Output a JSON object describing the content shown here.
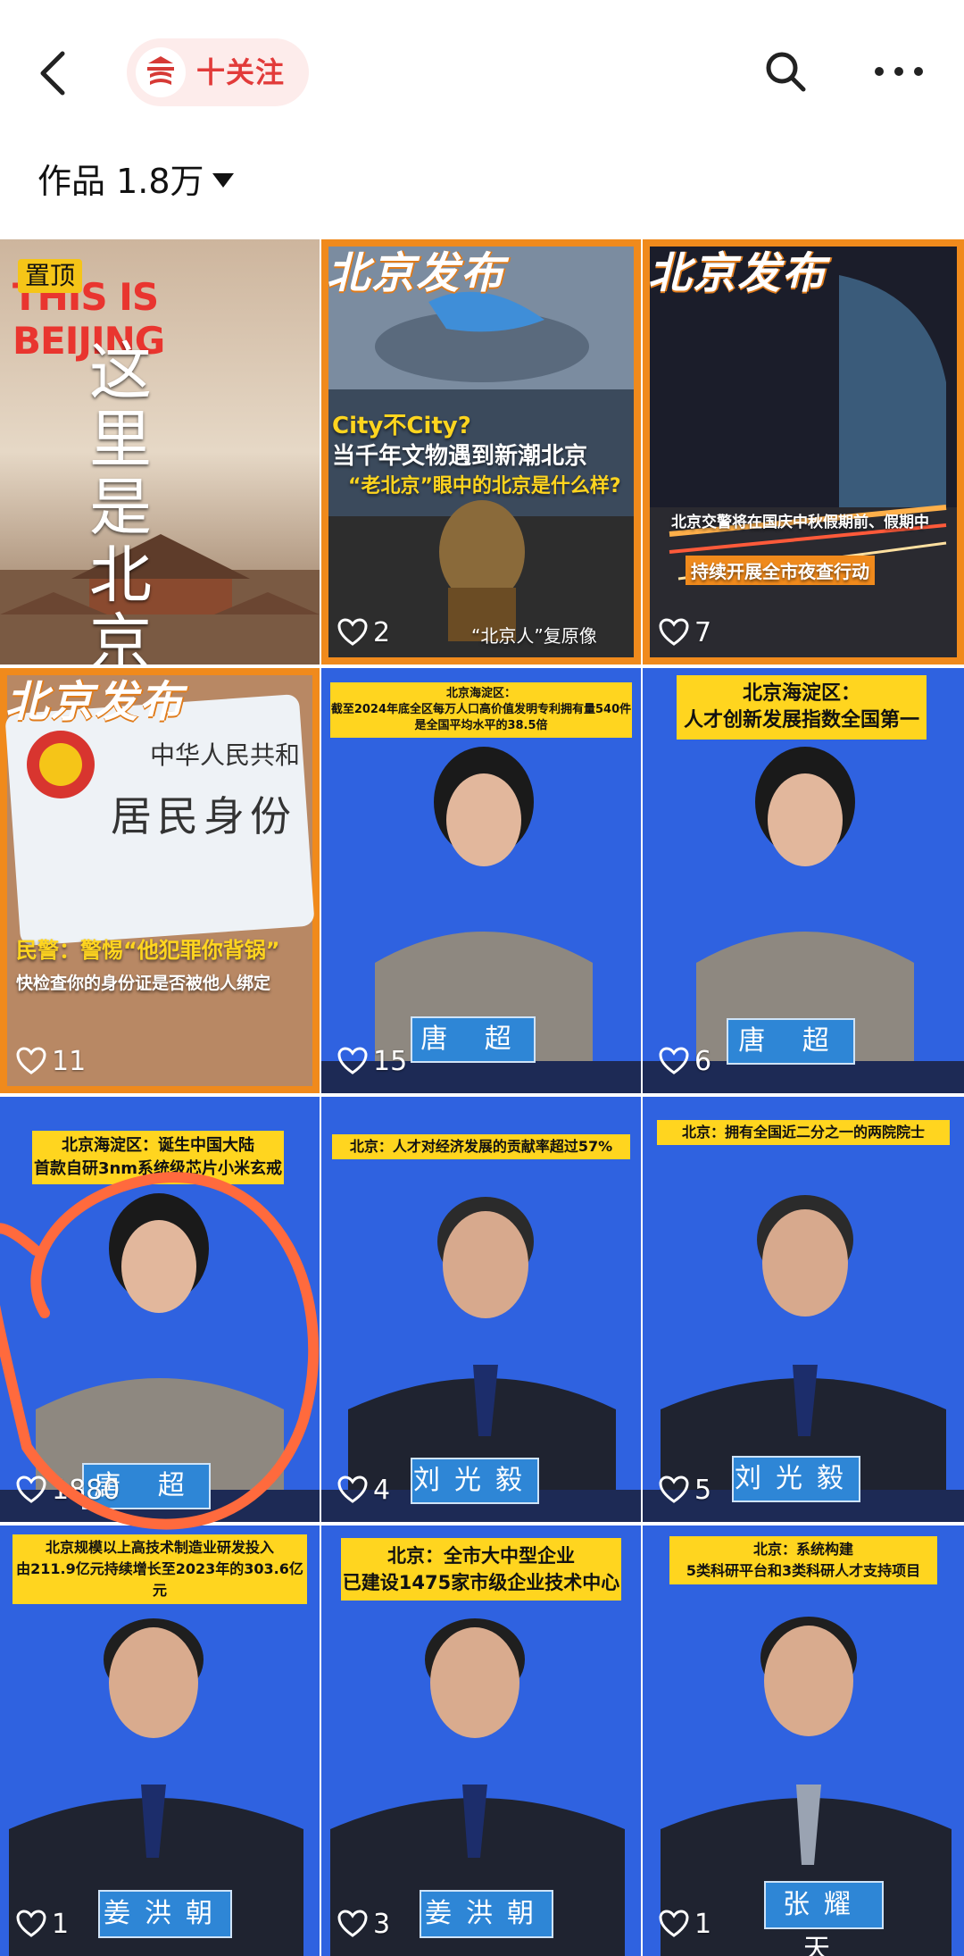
{
  "header": {
    "follow_label": "十关注",
    "works_label": "作品 1.8万"
  },
  "tiles": [
    {
      "pin": "置顶",
      "headline": "THIS IS BEIJING",
      "calligraphy": "这里是北京"
    },
    {
      "brand": "北京发布",
      "title1": "City不City?",
      "title2": "当千年文物遇到新潮北京",
      "title3": "“老北京”眼中的北京是什么样?",
      "footer": "“北京人”复原像",
      "likes": "2"
    },
    {
      "brand": "北京发布",
      "line1": "北京交警将在国庆中秋假期前、假期中",
      "line2": "持续开展全市夜查行动",
      "likes": "7"
    },
    {
      "brand": "北京发布",
      "card1": "中华人民共和",
      "card2": "居民身份",
      "warn1": "民警：警惕“他犯罪你背锅”",
      "warn2": "快检查你的身份证是否被他人绑定",
      "likes": "11"
    },
    {
      "caption1": "北京海淀区：",
      "caption2": "截至2024年底全区每万人口高价值发明专利拥有量540件",
      "caption3": "是全国平均水平的38.5倍",
      "nameplate": "唐 超",
      "likes": "15"
    },
    {
      "caption1": "北京海淀区：",
      "caption2": "人才创新发展指数全国第一",
      "nameplate": "唐 超",
      "likes": "6"
    },
    {
      "caption1": "北京海淀区：诞生中国大陆",
      "caption2": "首款自研3nm系统级芯片小米玄戒",
      "nameplate": "唐 超",
      "likes": "1880"
    },
    {
      "caption1": "北京：人才对经济发展的贡献率超过57%",
      "nameplate": "刘光毅",
      "likes": "4"
    },
    {
      "caption1": "北京：拥有全国近二分之一的两院院士",
      "nameplate": "刘光毅",
      "likes": "5"
    },
    {
      "caption1": "北京规模以上高技术制造业研发投入",
      "caption2": "由211.9亿元持续增长至2023年的303.6亿元",
      "nameplate": "姜洪朝",
      "likes": "1"
    },
    {
      "caption1": "北京：全市大中型企业",
      "caption2": "已建设1475家市级企业技术中心",
      "nameplate": "姜洪朝",
      "likes": "3"
    },
    {
      "caption1": "北京：系统构建",
      "caption2": "5类科研平台和3类科研人才支持项目",
      "nameplate": "张耀天",
      "likes": "1"
    }
  ],
  "colors": {
    "accent": "#e23b3a",
    "studio_blue": "#2f62e0",
    "caption_yellow": "#ffd51f",
    "orange_frame": "#f08a1c",
    "annotation_circle": "#ff6a3d"
  }
}
